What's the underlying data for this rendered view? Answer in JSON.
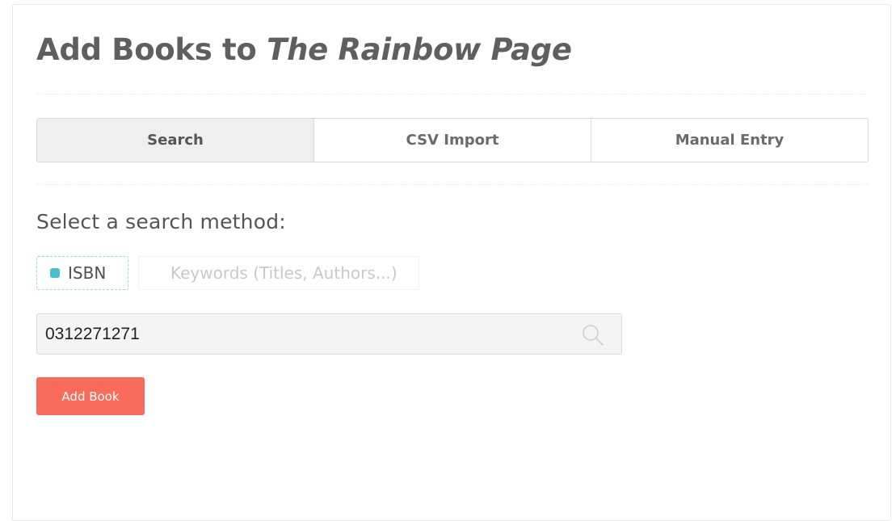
{
  "header": {
    "title_prefix": "Add Books to",
    "title_emphasis": "The Rainbow Page"
  },
  "tabs": [
    {
      "label": "Search",
      "active": true
    },
    {
      "label": "CSV Import",
      "active": false
    },
    {
      "label": "Manual Entry",
      "active": false
    }
  ],
  "search_method": {
    "heading": "Select a search method:",
    "options": [
      {
        "label": "ISBN",
        "selected": true
      },
      {
        "label": "Keywords (Titles, Authors...)",
        "selected": false
      }
    ]
  },
  "search": {
    "value": "0312271271",
    "icon": "search-icon"
  },
  "actions": {
    "add_book_label": "Add Book"
  },
  "colors": {
    "accent": "#47bfd1",
    "button": "#f96c5b"
  }
}
